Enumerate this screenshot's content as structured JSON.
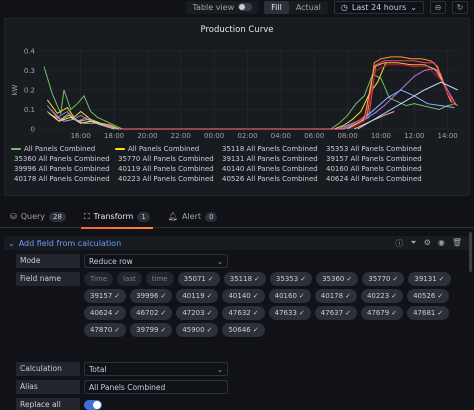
{
  "toolbar": {
    "table_view_label": "Table view",
    "fill_label": "Fill",
    "actual_label": "Actual",
    "time_range_label": "Last 24 hours"
  },
  "panel": {
    "title": "Production Curve"
  },
  "chart_data": {
    "type": "line",
    "title": "Production Curve",
    "ylabel": "kW",
    "xlabel": "",
    "ylim": [
      0,
      0.4
    ],
    "y_ticks": [
      "0",
      "0.1",
      "0.2",
      "0.3",
      "0.4"
    ],
    "x_ticks": [
      "16:00",
      "18:00",
      "20:00",
      "22:00",
      "00:00",
      "02:00",
      "04:00",
      "06:00",
      "08:00",
      "10:00",
      "12:00",
      "14:00"
    ],
    "x_hours": [
      16,
      18,
      20,
      22,
      24,
      26,
      28,
      30,
      32,
      34,
      36,
      38
    ],
    "grid": true,
    "legend_position": "bottom",
    "series": [
      {
        "name": "All Panels Combined",
        "color": "#73bf69",
        "x": [
          13.8,
          14.3,
          14.8,
          15.0,
          15.4,
          15.8,
          16.2,
          16.6,
          17.0,
          17.5,
          18.0,
          18.5,
          31.0,
          31.5,
          32.0,
          32.5,
          33.0,
          33.5,
          34.0,
          34.5,
          35.0,
          35.5,
          36.0,
          36.5,
          37.0,
          37.5,
          38.0,
          38.5
        ],
        "values": [
          0.32,
          0.18,
          0.08,
          0.2,
          0.1,
          0.13,
          0.17,
          0.09,
          0.06,
          0.04,
          0.02,
          0,
          0,
          0.03,
          0.07,
          0.13,
          0.17,
          0.28,
          0.26,
          0.16,
          0.14,
          0.12,
          0.13,
          0.12,
          0.11,
          0.1,
          0.12,
          0.13
        ]
      },
      {
        "name": "All Panels Combined",
        "color": "#fade2a",
        "x": [
          14.0,
          14.6,
          15.2,
          15.6,
          16.0,
          16.6,
          17.2,
          17.8,
          18.3,
          31.2,
          31.8,
          32.3,
          32.8,
          33.3,
          33.8,
          34.3
        ],
        "values": [
          0.15,
          0.08,
          0.11,
          0.06,
          0.09,
          0.05,
          0.03,
          0.02,
          0,
          0,
          0.02,
          0.05,
          0.09,
          0.18,
          0.24,
          0.34
        ]
      },
      {
        "name": "35118 All Panels Combined",
        "color": "#5794f2",
        "x": [
          14.0,
          14.6,
          15.2,
          15.6,
          16.0,
          16.6,
          17.2,
          17.8,
          18.3,
          31.4,
          32.0,
          32.6,
          33.2,
          33.6
        ],
        "values": [
          0.12,
          0.06,
          0.09,
          0.05,
          0.07,
          0.04,
          0.02,
          0.01,
          0,
          0,
          0.02,
          0.04,
          0.07,
          0.1
        ]
      },
      {
        "name": "35353 All Panels Combined",
        "color": "#ff9830",
        "x": [
          31.6,
          32.2,
          32.8,
          33.2,
          33.6,
          34.0,
          34.6,
          35.2,
          35.8,
          36.4,
          37.0,
          37.4,
          37.8,
          38.2,
          38.6
        ],
        "values": [
          0,
          0.02,
          0.05,
          0.08,
          0.34,
          0.36,
          0.37,
          0.37,
          0.36,
          0.36,
          0.35,
          0.32,
          0.22,
          0.14,
          0.12
        ]
      },
      {
        "name": "35360 All Panels Combined",
        "color": "#f2495c",
        "x": [
          31.6,
          32.2,
          32.8,
          33.3,
          33.7,
          34.2,
          34.8,
          35.4,
          36.0,
          36.6,
          37.2,
          37.6,
          38.0,
          38.5
        ],
        "values": [
          0,
          0.02,
          0.05,
          0.08,
          0.33,
          0.35,
          0.35,
          0.35,
          0.35,
          0.34,
          0.34,
          0.28,
          0.18,
          0.13
        ]
      },
      {
        "name": "35770 All Panels Combined",
        "color": "#b877d9",
        "x": [
          31.8,
          32.4,
          33.0,
          33.6,
          34.2,
          34.8,
          35.4,
          36.0,
          36.6,
          37.2,
          37.8,
          38.4
        ],
        "values": [
          0,
          0.02,
          0.05,
          0.08,
          0.12,
          0.17,
          0.22,
          0.27,
          0.3,
          0.31,
          0.23,
          0.14
        ]
      },
      {
        "name": "39131 All Panels Combined",
        "color": "#ff7383",
        "x": [
          14.2,
          14.8,
          15.3,
          15.8,
          16.4,
          17.0,
          17.6,
          18.2,
          31.8,
          32.6,
          33.3
        ],
        "values": [
          0.1,
          0.05,
          0.08,
          0.04,
          0.06,
          0.03,
          0.02,
          0,
          0,
          0.03,
          0.06
        ]
      },
      {
        "name": "39157 All Panels Combined",
        "color": "#8ab8ff",
        "x": [
          32.0,
          32.8,
          33.6,
          34.4,
          35.2,
          36.0,
          36.8,
          37.6,
          38.4
        ],
        "values": [
          0,
          0.04,
          0.1,
          0.16,
          0.2,
          0.17,
          0.13,
          0.12,
          0.11
        ]
      },
      {
        "name": "39996 All Panels Combined",
        "color": "#96d98d",
        "x": [
          14.0,
          14.7,
          15.3,
          15.9,
          16.5,
          17.1,
          17.7,
          18.3
        ],
        "values": [
          0.09,
          0.04,
          0.07,
          0.04,
          0.05,
          0.03,
          0.01,
          0
        ]
      },
      {
        "name": "40119 All Panels Combined",
        "color": "#ffee52",
        "x": [
          14.1,
          14.7,
          15.4,
          16.0,
          16.6,
          17.3,
          18.0
        ],
        "values": [
          0.08,
          0.04,
          0.06,
          0.03,
          0.04,
          0.02,
          0
        ]
      },
      {
        "name": "40140 All Panels Combined",
        "color": "#5794f2",
        "x": [
          31.8,
          32.6,
          33.2,
          33.8
        ],
        "values": [
          0,
          0.03,
          0.06,
          0.09
        ]
      },
      {
        "name": "40160 All Panels Combined",
        "color": "#ffb357",
        "x": [
          32.0,
          33.0,
          33.6,
          34.2,
          35.0,
          35.8,
          36.6,
          37.4,
          38.2
        ],
        "values": [
          0,
          0.05,
          0.32,
          0.34,
          0.34,
          0.33,
          0.33,
          0.3,
          0.14
        ]
      },
      {
        "name": "40178 All Panels Combined",
        "color": "#c4162a",
        "x": [
          32.2,
          33.0,
          33.7,
          34.4,
          35.2,
          36.0,
          36.8,
          37.6,
          38.4
        ],
        "values": [
          0,
          0.04,
          0.3,
          0.33,
          0.33,
          0.32,
          0.32,
          0.25,
          0.12
        ]
      },
      {
        "name": "40223 All Panels Combined",
        "color": "#ca95e5",
        "x": [
          14.3,
          15.0,
          15.6,
          16.2,
          16.9,
          17.6,
          18.2
        ],
        "values": [
          0.07,
          0.04,
          0.05,
          0.03,
          0.03,
          0.01,
          0
        ]
      },
      {
        "name": "40526 All Panels Combined",
        "color": "#ffa6b0",
        "x": [
          32.4,
          33.4,
          34.2,
          34.8
        ],
        "values": [
          0,
          0.04,
          0.07,
          0.09
        ]
      },
      {
        "name": "40624 All Panels Combined",
        "color": "#c0d8ff",
        "x": [
          32.6,
          33.6,
          34.6,
          35.6,
          36.6,
          37.6,
          38.6
        ],
        "values": [
          0,
          0.05,
          0.1,
          0.15,
          0.2,
          0.24,
          0.2
        ]
      }
    ]
  },
  "tabs": [
    {
      "label": "Query",
      "count": "28"
    },
    {
      "label": "Transform",
      "count": "1"
    },
    {
      "label": "Alert",
      "count": "0"
    }
  ],
  "transform": {
    "title": "Add field from calculation",
    "mode_label": "Mode",
    "mode_value": "Reduce row",
    "field_name_label": "Field name",
    "fields": [
      {
        "label": "Time",
        "selected": false
      },
      {
        "label": "last",
        "selected": false
      },
      {
        "label": "time",
        "selected": false
      },
      {
        "label": "35071",
        "selected": true
      },
      {
        "label": "35118",
        "selected": true
      },
      {
        "label": "35353",
        "selected": true
      },
      {
        "label": "35360",
        "selected": true
      },
      {
        "label": "35770",
        "selected": true
      },
      {
        "label": "39131",
        "selected": true
      },
      {
        "label": "39157",
        "selected": true
      },
      {
        "label": "39996",
        "selected": true
      },
      {
        "label": "40119",
        "selected": true
      },
      {
        "label": "40140",
        "selected": true
      },
      {
        "label": "40160",
        "selected": true
      },
      {
        "label": "40178",
        "selected": true
      },
      {
        "label": "40223",
        "selected": true
      },
      {
        "label": "40526",
        "selected": true
      },
      {
        "label": "40624",
        "selected": true
      },
      {
        "label": "46702",
        "selected": true
      },
      {
        "label": "47203",
        "selected": true
      },
      {
        "label": "47632",
        "selected": true
      },
      {
        "label": "47633",
        "selected": true
      },
      {
        "label": "47637",
        "selected": true
      },
      {
        "label": "47679",
        "selected": true
      },
      {
        "label": "47681",
        "selected": true
      },
      {
        "label": "47870",
        "selected": true
      },
      {
        "label": "39799",
        "selected": true
      },
      {
        "label": "45900",
        "selected": true
      },
      {
        "label": "50646",
        "selected": true
      }
    ],
    "calculation_label": "Calculation",
    "calculation_value": "Total",
    "alias_label": "Alias",
    "alias_value": "All Panels Combined",
    "replace_label": "Replace all fields",
    "replace_on": true
  }
}
